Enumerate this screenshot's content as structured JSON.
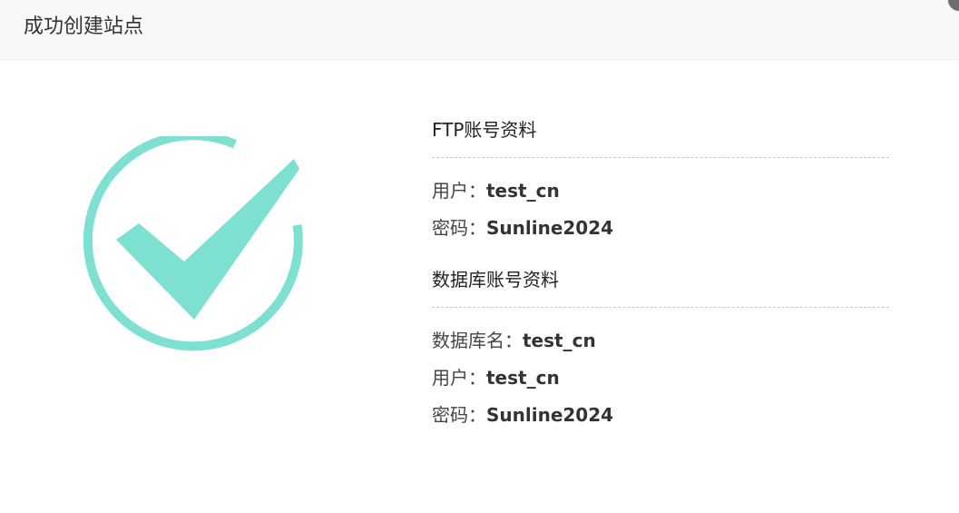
{
  "dialog": {
    "title": "成功创建站点"
  },
  "icons": {
    "success": "check-circle-icon",
    "close": "close-icon"
  },
  "colors": {
    "accent": "#7ee0d0",
    "titlebar_bg": "#f8f8f8"
  },
  "ftp": {
    "heading": "FTP账号资料",
    "user_label": "用户：",
    "user_value": "test_cn",
    "password_label": "密码：",
    "password_value": "Sunline2024"
  },
  "database": {
    "heading": "数据库账号资料",
    "dbname_label": "数据库名：",
    "dbname_value": "test_cn",
    "user_label": "用户：",
    "user_value": "test_cn",
    "password_label": "密码：",
    "password_value": "Sunline2024"
  }
}
